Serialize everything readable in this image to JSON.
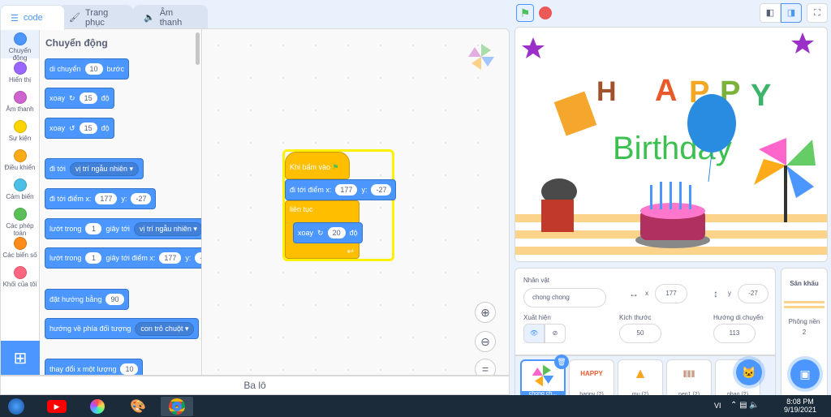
{
  "tabs": {
    "code": "code",
    "costumes": "Trang phục",
    "sounds": "Âm thanh"
  },
  "categories": [
    {
      "label": "Chuyển động",
      "color": "#4c97ff"
    },
    {
      "label": "Hiển thị",
      "color": "#9966ff"
    },
    {
      "label": "Âm thanh",
      "color": "#cf63cf"
    },
    {
      "label": "Sự kiện",
      "color": "#ffd500"
    },
    {
      "label": "Điều khiển",
      "color": "#ffab19"
    },
    {
      "label": "Cảm biến",
      "color": "#4cbfe6"
    },
    {
      "label": "Các phép toán",
      "color": "#59c059"
    },
    {
      "label": "Các biến số",
      "color": "#ff8c1a"
    },
    {
      "label": "Khối của tôi",
      "color": "#ff6680"
    }
  ],
  "palette": {
    "title": "Chuyển động",
    "move": {
      "a": "di chuyển",
      "v": "10",
      "b": "bước"
    },
    "turn_right": {
      "a": "xoay",
      "v": "15",
      "b": "độ"
    },
    "turn_left": {
      "a": "xoay",
      "v": "15",
      "b": "độ"
    },
    "goto": {
      "a": "đi tới",
      "dd": "vị trí ngẫu nhiên"
    },
    "goto_xy": {
      "a": "đi tới điểm x:",
      "x": "177",
      "yl": "y:",
      "y": "-27"
    },
    "glide": {
      "a": "lướt trong",
      "v": "1",
      "b": "giây tới",
      "dd": "vị trí ngẫu nhiên"
    },
    "glide_xy": {
      "a": "lướt trong",
      "v": "1",
      "b": "giây tới điểm x:",
      "x": "177",
      "yl": "y:",
      "y": "-2"
    },
    "point": {
      "a": "đặt hướng bằng",
      "v": "90"
    },
    "point_towards": {
      "a": "hướng về phía đối tượng",
      "dd": "con trỏ chuột"
    },
    "change_x": {
      "a": "thay đổi x một lượng",
      "v": "10"
    }
  },
  "script": {
    "hat": "Khi bấm vào",
    "goto_xy": {
      "a": "đi tới điểm x:",
      "x": "177",
      "yl": "y:",
      "y": "-27"
    },
    "forever": "liên tục",
    "turn": {
      "a": "xoay",
      "v": "20",
      "b": "độ"
    }
  },
  "backpack": "Ba lô",
  "stage": {
    "birthday": "Birthday"
  },
  "sprite_info": {
    "sprite_label": "Nhân vật",
    "sprite_name": "chong chong",
    "x_label": "x",
    "x": "177",
    "y_label": "y",
    "y": "-27",
    "show_label": "Xuất hiện",
    "size_label": "Kích thước",
    "size": "50",
    "direction_label": "Hướng di chuyển",
    "direction": "113"
  },
  "sprites": [
    "chong ch...",
    "happy (2)",
    "mu (2)",
    "nen1 (2)",
    "phao (2)"
  ],
  "stage_panel": {
    "title": "Sân khấu",
    "backdrops_label": "Phông nền",
    "backdrops": "2"
  },
  "taskbar": {
    "lang": "VI",
    "time": "8:08 PM",
    "date": "9/19/2021"
  }
}
